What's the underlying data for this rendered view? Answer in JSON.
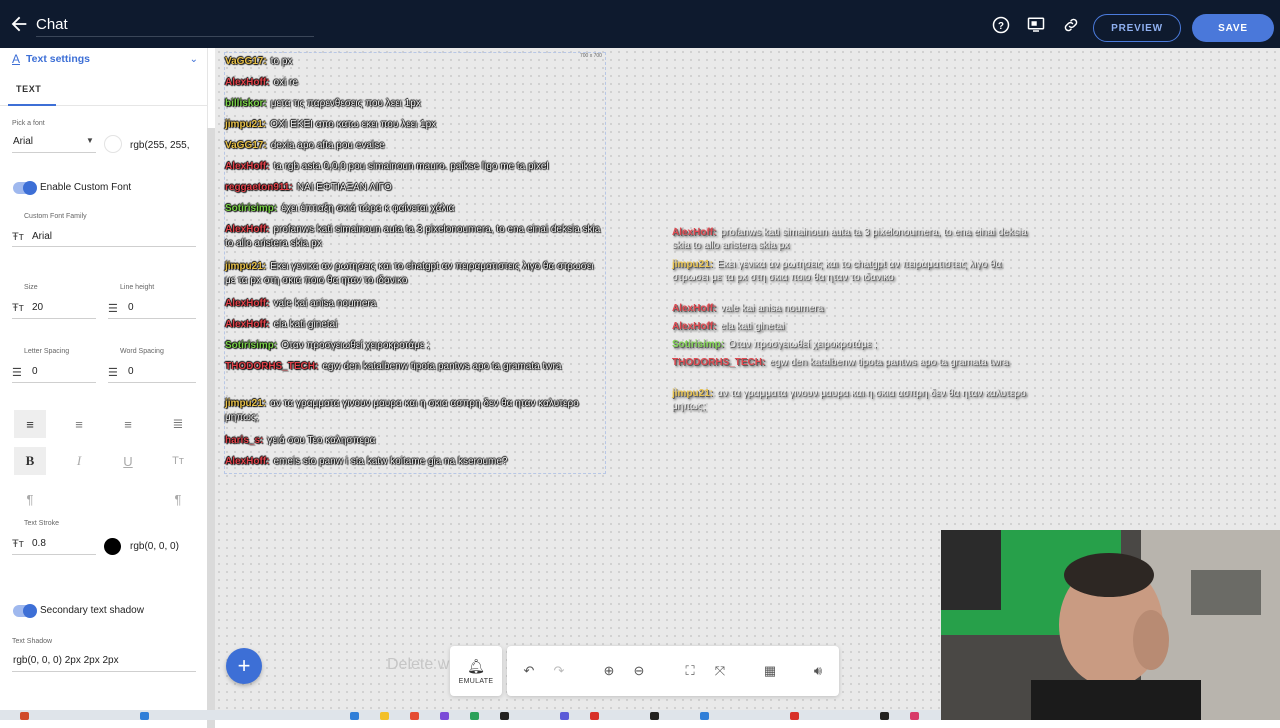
{
  "header": {
    "title": "Chat",
    "preview_label": "PREVIEW",
    "save_label": "SAVE",
    "icons": [
      "back-arrow-icon",
      "help-icon",
      "monitor-icon",
      "link-icon"
    ]
  },
  "panel": {
    "section_title": "Text settings",
    "tab": "TEXT",
    "font_label": "Pick a font",
    "font_value": "Arial",
    "font_color": "rgb(255, 255,",
    "custom_font_toggle": "Enable Custom Font",
    "custom_font_label": "Custom Font Family",
    "custom_font_value": "Arial",
    "size_label": "Size",
    "size_value": "20",
    "line_height_label": "Line height",
    "line_height_value": "0",
    "letter_spacing_label": "Letter Spacing",
    "letter_spacing_value": "0",
    "word_spacing_label": "Word Spacing",
    "word_spacing_value": "0",
    "stroke_label": "Text Stroke",
    "stroke_value": "0.8",
    "stroke_color": "rgb(0, 0, 0)",
    "secondary_shadow_toggle": "Secondary text shadow",
    "shadow_label": "Text Shadow",
    "shadow_value": "rgb(0, 0, 0) 2px 2px 2px"
  },
  "canvas": {
    "size_badge": "700 x 700",
    "delete_hint": "Delete w",
    "emulate_label": "EMULATE",
    "chat_messages": [
      {
        "user": "VaGG17:",
        "text": "to px",
        "color": "#e8c14a"
      },
      {
        "user": "AlexHoff:",
        "text": "oxi re",
        "color": "#e0424a"
      },
      {
        "user": "billiskor:",
        "text": "μετα τις παρενθεσεις που λεει 1px",
        "color": "#7bd24a"
      },
      {
        "user": "jimpu21:",
        "text": "ΟΧΙ ΕΚΕΙ απο κατω εκει που λεει 1px",
        "color": "#e8c14a"
      },
      {
        "user": "VaGG17:",
        "text": "dexia apo afta pou evalse",
        "color": "#e8c14a"
      },
      {
        "user": "AlexHoff:",
        "text": "ta rgb asta 0,0,0 pou simainoun mauro. paikse ligo me ta pixel",
        "color": "#e0424a"
      },
      {
        "user": "reggaeton911:",
        "text": "ΝΑΙ ΕΦΤΙΑΞΑΝ ΛΙΓΟ",
        "color": "#e0424a"
      },
      {
        "user": "Sotirisimp:",
        "text": "έχει έπτιαξη σκιά τώρα κ φαίνεται χάλια",
        "color": "#7bd24a"
      },
      {
        "user": "AlexHoff:",
        "text": "profanws kati simainoun auta ta 3 pixelonoumera, to ena einai deksia skia to allo aristera skia px",
        "color": "#e0424a"
      },
      {
        "user": "jimpu21:",
        "text": "Εκει γενικα αν ρωτησεις και το chatgpt αν πειραματιστεις λιγο θα στρωσει με τα px στη σκια ποιο θα ηταν το ιδανικο",
        "color": "#e8c14a"
      },
      {
        "user": "AlexHoff:",
        "text": "vale kai anisa noumera",
        "color": "#e0424a"
      },
      {
        "user": "AlexHoff:",
        "text": "ela kati ginetai",
        "color": "#e0424a"
      },
      {
        "user": "Sotirisimp:",
        "text": "Οταν προσγειωθεί χειροκροτάμε ;",
        "color": "#7bd24a"
      },
      {
        "user": "THODORHS_TECH:",
        "text": "egw den katalbenw tipota pantws apo ta gramata twra",
        "color": "#e0424a"
      },
      {
        "user": "jimpu21:",
        "text": "αν τα γραμματα γινουν μαυρα και η σκια ασπρη δεν θα ηταν καλυτερο μηπως;",
        "color": "#e8c14a"
      },
      {
        "user": "haris_s:",
        "text": "γειά σου Τεο καλησπερα",
        "color": "#e0424a"
      },
      {
        "user": "AlexHoff:",
        "text": "emeis sto panw i sta katw koitame gia na kseroume?",
        "color": "#e0424a"
      }
    ],
    "preview_messages": [
      {
        "user": "AlexHoff:",
        "text": "profanws kati simainoun auta ta 3 pixelonoumera, to ena einai deksia skia to allo aristera skia px",
        "color": "#e0424a"
      },
      {
        "user": "jimpu21:",
        "text": "Εκει γενικα αν ρωτησεις και το chatgpt αν πειραματιστεις λιγο θα στρωσει με τα px στη σκια ποιο θα ηταν το ιδανικο",
        "color": "#e8c14a"
      },
      {
        "user": "AlexHoff:",
        "text": "vale kai anisa noumera",
        "color": "#e0424a"
      },
      {
        "user": "AlexHoff:",
        "text": "ela kati ginetai",
        "color": "#e0424a"
      },
      {
        "user": "Sotirisimp:",
        "text": "Οταν προσγειωθεί χειροκροτάμε ;",
        "color": "#7bd24a"
      },
      {
        "user": "THODORHS_TECH:",
        "text": "egw den katalbenw tipota pantws apo ta gramata twra",
        "color": "#e0424a"
      },
      {
        "user": "jimpu21:",
        "text": "αν τα γραμματα γινουν μαυρα και η σκια ασπρη δεν θα ηταν καλυτερο μηπως;",
        "color": "#e8c14a"
      }
    ]
  }
}
